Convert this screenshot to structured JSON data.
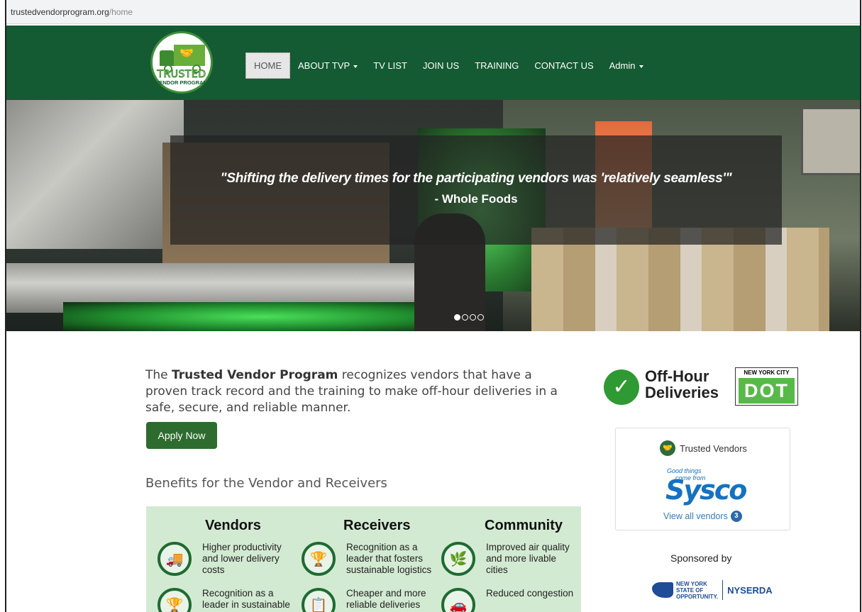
{
  "browser": {
    "url_host": "trustedvendorprogram.org",
    "url_path": "/home"
  },
  "logo": {
    "line1": "TRUSTED",
    "line2": "VENDOR PROGRAM"
  },
  "nav": {
    "home": "HOME",
    "about": "ABOUT TVP",
    "tvlist": "TV LIST",
    "join": "JOIN US",
    "training": "TRAINING",
    "contact": "CONTACT US",
    "admin": "Admin"
  },
  "hero": {
    "quote": "\"Shifting the delivery times for the participating vendors was 'relatively seamless'\"",
    "author": "- Whole Foods",
    "slides_total": 4,
    "active_slide": 1
  },
  "intro": {
    "before": "The ",
    "bold": "Trusted Vendor Program",
    "after": " recognizes vendors that have a proven track record and the training to make off-hour deliveries in a safe, secure, and reliable manner."
  },
  "apply_button": "Apply Now",
  "benefits_heading": "Benefits for the Vendor and Receivers",
  "benefits": {
    "vendors": {
      "title": "Vendors",
      "items": [
        "Higher productivity and lower delivery costs",
        "Recognition as a leader in sustainable"
      ]
    },
    "receivers": {
      "title": "Receivers",
      "items": [
        "Recognition as a leader that fosters sustainable logistics",
        "Cheaper and more reliable deliveries"
      ]
    },
    "community": {
      "title": "Community",
      "items": [
        "Improved air quality and more livable cities",
        "Reduced congestion"
      ]
    }
  },
  "off_hour": {
    "line1": "Off-Hour",
    "line2": "Deliveries",
    "dot_top": "NEW YORK CITY",
    "dot_text": "DOT"
  },
  "tv_card": {
    "heading": "Trusted Vendors",
    "sysco_tag1": "Good things",
    "sysco_tag2": "come from",
    "sysco_brand": "Sysco",
    "view_all": "View all vendors",
    "count": "3"
  },
  "sponsored": {
    "label": "Sponsored by",
    "ny1": "NEW YORK",
    "ny2": "STATE OF",
    "ny3": "OPPORTUNITY.",
    "nyserda": "NYSERDA"
  },
  "colors": {
    "brand_green": "#145a32",
    "button_green": "#2e6b2e",
    "panel_green": "#d3ead2"
  }
}
